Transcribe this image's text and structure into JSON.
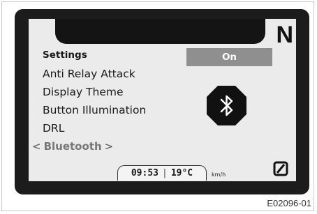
{
  "header": {
    "gear_indicator": "N"
  },
  "menu": {
    "title": "Settings",
    "items": [
      {
        "label": "Anti Relay Attack"
      },
      {
        "label": "Display Theme"
      },
      {
        "label": "Button Illumination"
      },
      {
        "label": "DRL"
      }
    ],
    "selected": {
      "label": "Bluetooth",
      "prev_arrow": "<",
      "next_arrow": ">"
    }
  },
  "toggle": {
    "value": "On"
  },
  "icons": {
    "bluetooth": "bluetooth-icon",
    "odometer_zero": "zero-slash-icon"
  },
  "status_bar": {
    "time": "09:53",
    "separator": "|",
    "temperature": "19°C",
    "speed_unit": "km/h"
  },
  "figure_label": "E02096-01",
  "colors": {
    "bezel": "#1c1c1c",
    "screen": "#ebebeb",
    "toggle_bg": "#8f8f8f",
    "selected_item": "#777777"
  }
}
